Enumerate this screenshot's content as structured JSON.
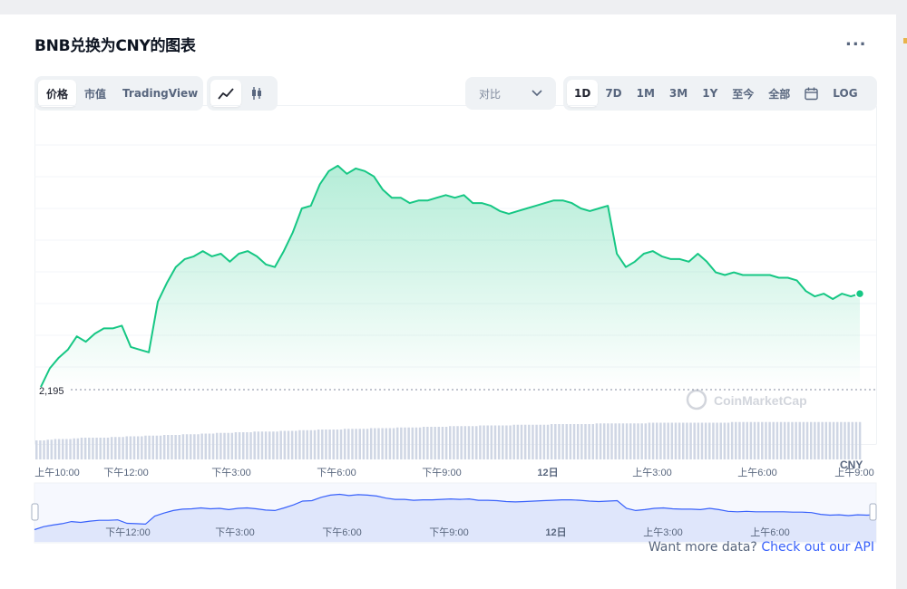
{
  "title": "BNB兑换为CNY的图表",
  "more_label": "...",
  "type_tabs": [
    "价格",
    "市值",
    "TradingView"
  ],
  "compare": {
    "label": "对比"
  },
  "range_tabs": [
    "1D",
    "7D",
    "1M",
    "3M",
    "1Y",
    "至今",
    "全部"
  ],
  "log_label": "LOG",
  "api": {
    "text": "Want more data? ",
    "link": "Check out our API"
  },
  "colors": {
    "line": "#16c784",
    "accent": "#3861fb",
    "volume": "#cfd6e4",
    "nav_fill": "#dfe6fb"
  },
  "chart_data": {
    "type": "area",
    "baseline_label": "2,195",
    "currency_label": "CNY",
    "watermark": "CoinMarketCap",
    "x_labels": [
      "上午10:00",
      "下午12:00",
      "下午3:00",
      "下午6:00",
      "下午9:00",
      "12日",
      "上午3:00",
      "上午6:00",
      "上午9:00"
    ],
    "nav_labels": [
      "下午12:00",
      "下午3:00",
      "下午6:00",
      "下午9:00",
      "12日",
      "上午3:00",
      "上午6:00"
    ],
    "series": [
      {
        "values": [
          2191,
          2198,
          2202,
          2205,
          2210,
          2208,
          2211,
          2213,
          2213,
          2214,
          2206,
          2205,
          2204,
          2223,
          2230,
          2236,
          2239,
          2240,
          2242,
          2240,
          2241,
          2238,
          2241,
          2242,
          2240,
          2237,
          2236,
          2242,
          2249,
          2258,
          2259,
          2267,
          2272,
          2274,
          2271,
          2273,
          2272,
          2270,
          2265,
          2262,
          2262,
          2260,
          2261,
          2261,
          2262,
          2263,
          2262,
          2263,
          2260,
          2260,
          2259,
          2257,
          2256,
          2257,
          2258,
          2259,
          2260,
          2261,
          2261,
          2260,
          2258,
          2257,
          2258,
          2259,
          2241,
          2236,
          2238,
          2241,
          2242,
          2240,
          2239,
          2239,
          2238,
          2241,
          2238,
          2234,
          2233,
          2234,
          2233,
          2233,
          2233,
          2233,
          2232,
          2232,
          2231,
          2227,
          2225,
          2226,
          2224,
          2226,
          2225,
          2226
        ],
        "volume": [
          28,
          29,
          30,
          30,
          31,
          32,
          32,
          32,
          33,
          33,
          34,
          34,
          35,
          35,
          36,
          36,
          37,
          37,
          38,
          38,
          39,
          39,
          40,
          40,
          41,
          41,
          41,
          42,
          42,
          43,
          43,
          44,
          44,
          44,
          45,
          45,
          45,
          46,
          46,
          46,
          47,
          47,
          47,
          48,
          48,
          48,
          49,
          49,
          49,
          50,
          50,
          50,
          50,
          51,
          51,
          51,
          51,
          52,
          52,
          52,
          52,
          52,
          53,
          53,
          53,
          53,
          53,
          53,
          54,
          54,
          54,
          54,
          54,
          54,
          54,
          54,
          54,
          55,
          55,
          55,
          55,
          55,
          55,
          55,
          55,
          55,
          55,
          55,
          55,
          55,
          55,
          55
        ]
      }
    ]
  }
}
